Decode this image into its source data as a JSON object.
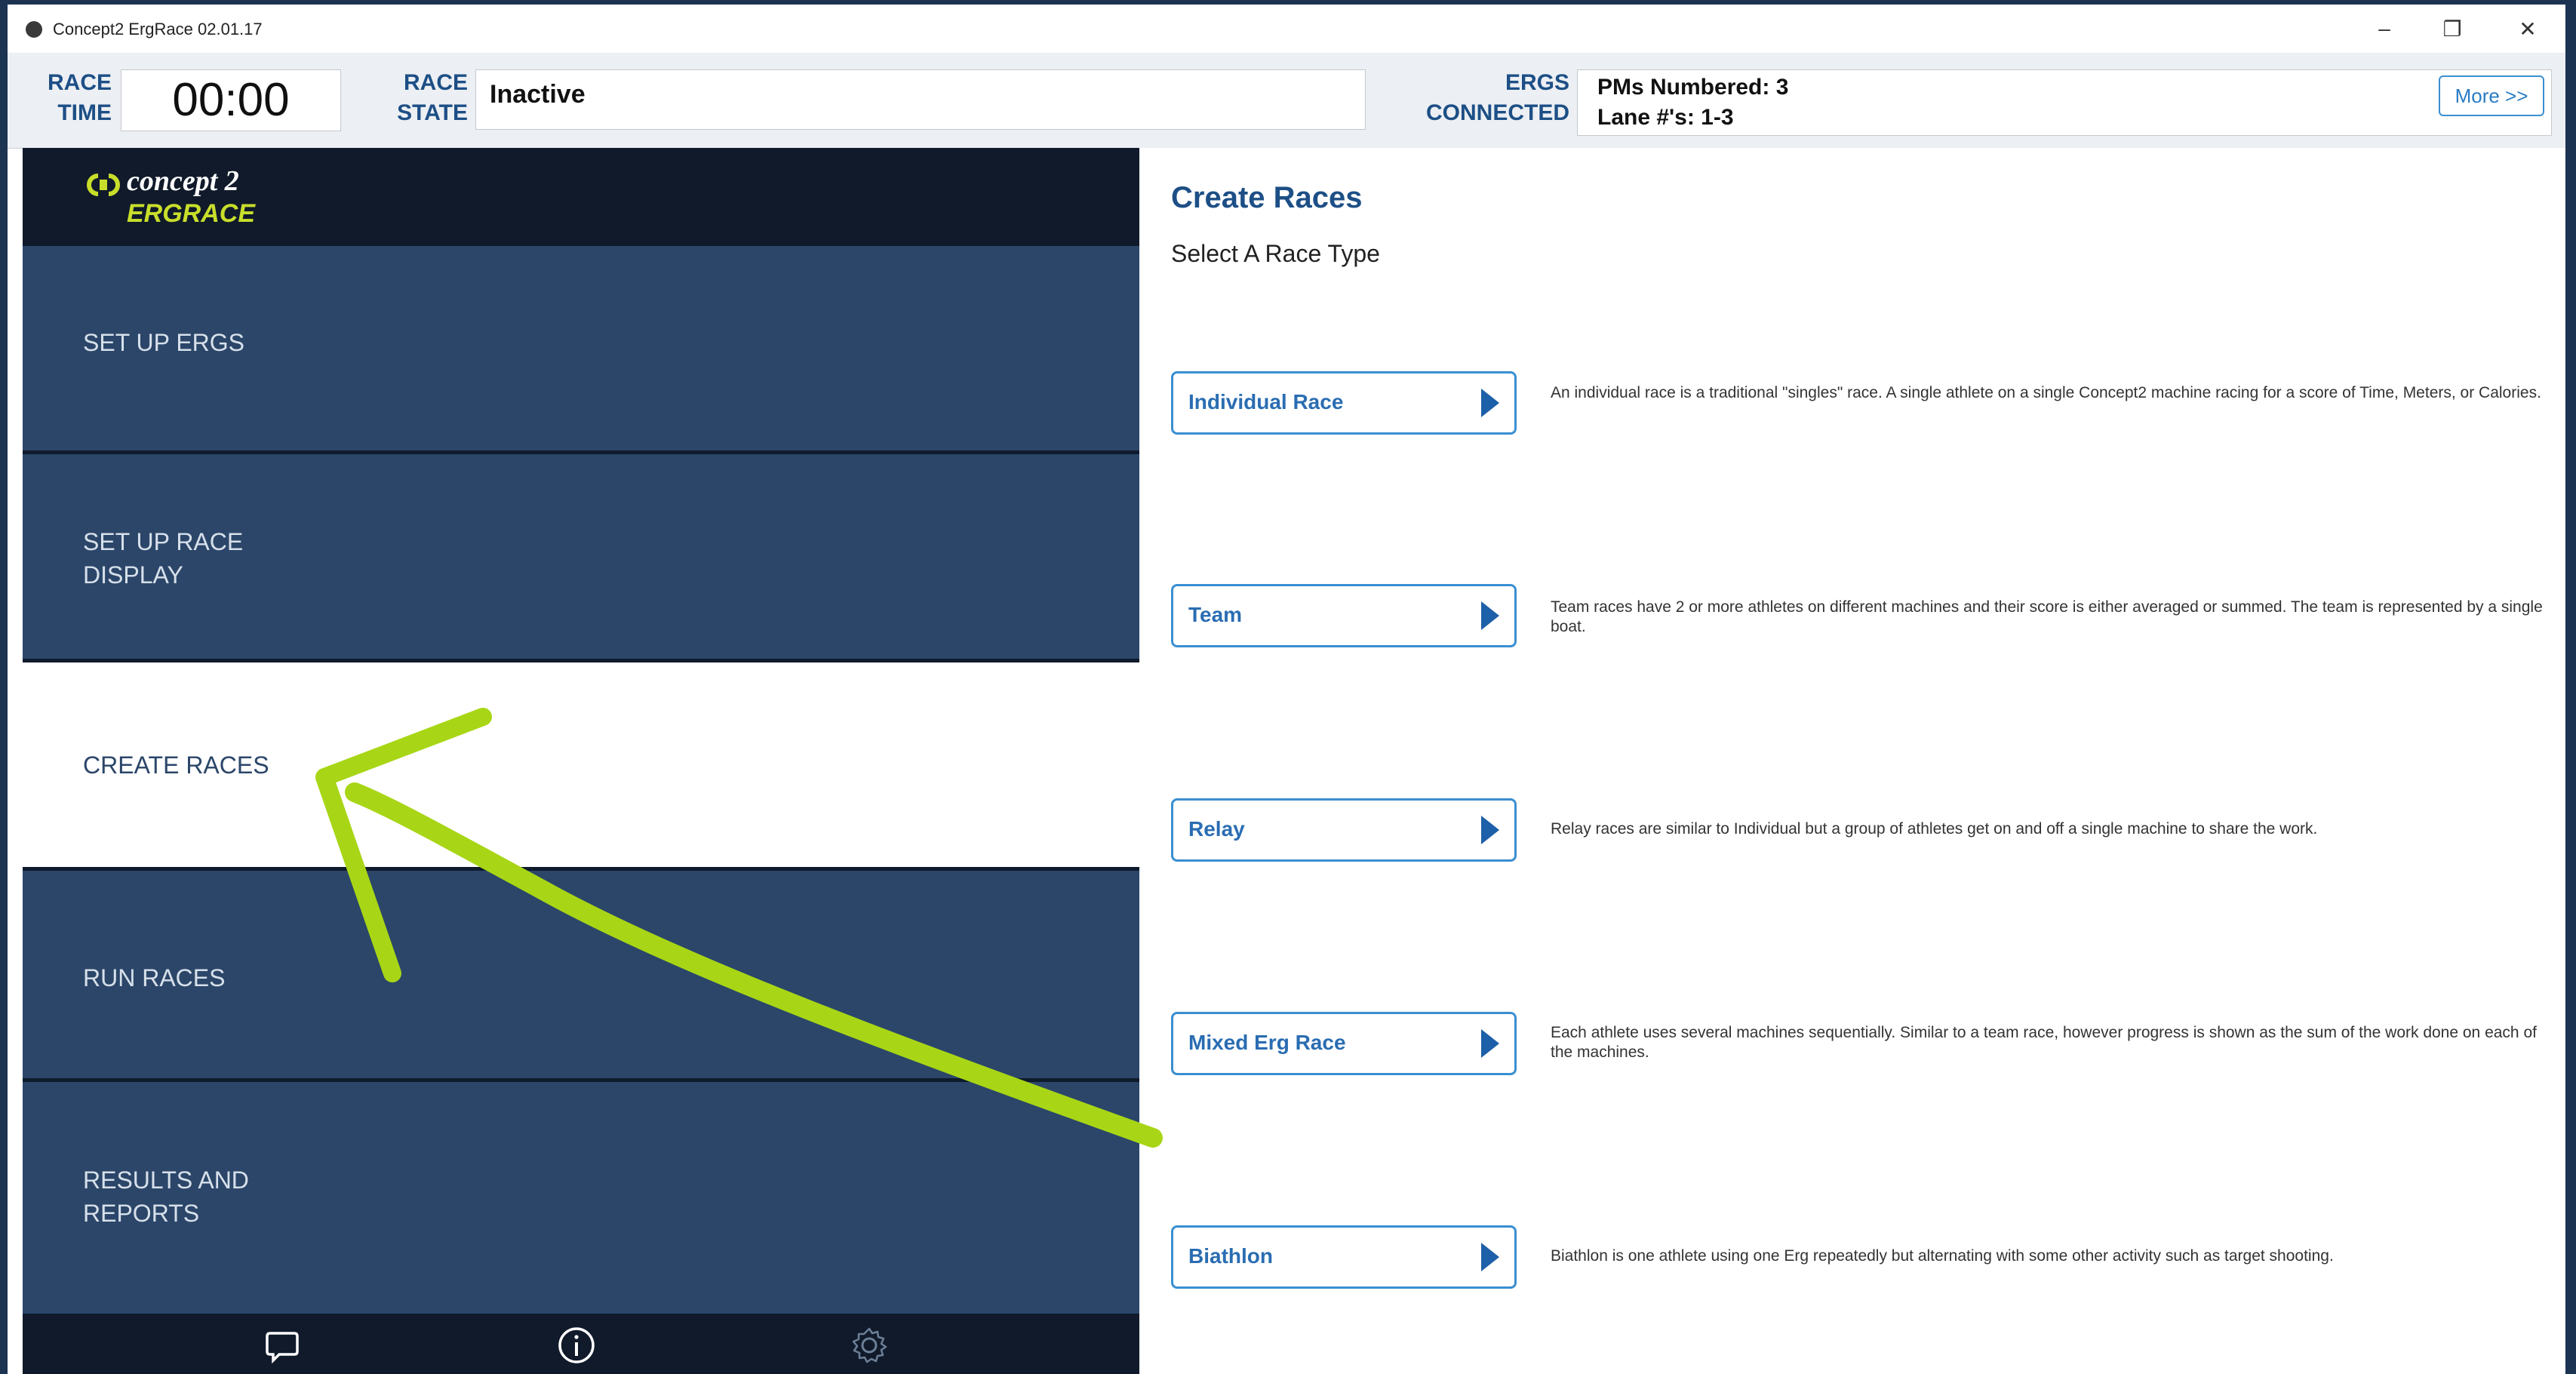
{
  "window": {
    "title": "Concept2 ErgRace 02.01.17",
    "controls": {
      "minimize": "–",
      "maximize": "❐",
      "close": "✕"
    }
  },
  "status": {
    "race_time_label": [
      "RACE",
      "TIME"
    ],
    "race_time": "00:00",
    "race_state_label": [
      "RACE",
      "STATE"
    ],
    "race_state": "Inactive",
    "ergs_label": [
      "ERGS",
      "CONNECTED"
    ],
    "pms_numbered": "PMs Numbered: 3",
    "lanes": "Lane #'s: 1-3",
    "more_button": "More >>"
  },
  "logo": {
    "line1": "concept 2",
    "line2": "ERGRACE"
  },
  "sidebar": {
    "items": [
      {
        "label": "SET UP ERGS",
        "active": false
      },
      {
        "label": "SET UP RACE\nDISPLAY",
        "active": false
      },
      {
        "label": "CREATE RACES",
        "active": true
      },
      {
        "label": "RUN RACES",
        "active": false
      },
      {
        "label": "RESULTS AND\nREPORTS",
        "active": false
      }
    ],
    "footer_icons": [
      "chat-icon",
      "info-icon",
      "gear-icon"
    ]
  },
  "main": {
    "title": "Create Races",
    "subtitle": "Select A Race Type",
    "race_types": [
      {
        "label": "Individual Race",
        "description": "An individual race is a traditional \"singles\" race. A single athlete on a single Concept2 machine racing for a score of Time, Meters, or Calories."
      },
      {
        "label": "Team",
        "description": "Team races have 2 or more athletes on different machines and their score is either averaged or summed.  The team is represented by a single boat."
      },
      {
        "label": "Relay",
        "description": "Relay races are similar to Individual but a group of athletes get on and off a single machine to share the work."
      },
      {
        "label": "Mixed Erg Race",
        "description": "Each athlete uses several machines sequentially. Similar to a team race, however progress is shown as the sum of the work done on each of the machines."
      },
      {
        "label": "Biathlon",
        "description": "Biathlon is one athlete using one Erg repeatedly but alternating with some other activity such as target shooting."
      }
    ]
  },
  "colors": {
    "accent_blue": "#1d4f86",
    "sidebar_bg": "#2b4669",
    "annotation_arrow": "#a8d616"
  }
}
